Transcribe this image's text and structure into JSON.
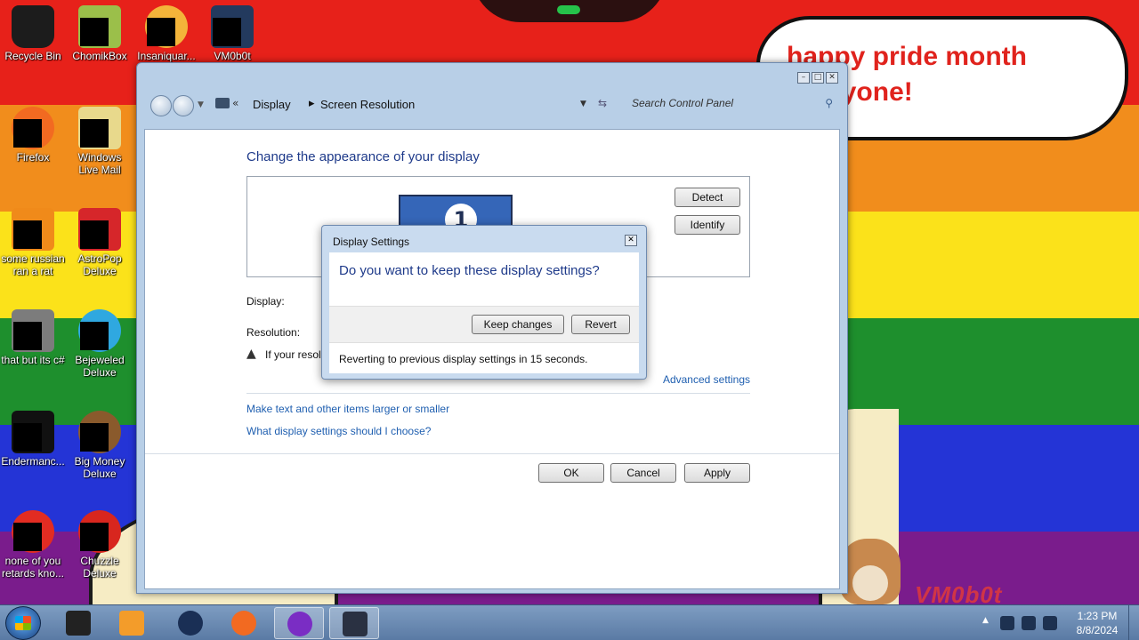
{
  "wallpaper": {
    "bubble_text": "happy pride month everyone!",
    "watermark": "VM0b0t",
    "colors": [
      "#e7211a",
      "#f18d1c",
      "#fbe21a",
      "#1e8f2d",
      "#2434d6",
      "#7a1c8c"
    ]
  },
  "desktop_icons": [
    {
      "label": "Recycle Bin",
      "icon": "recycle-bin-icon"
    },
    {
      "label": "ChomikBox",
      "icon": "chomikbox-icon"
    },
    {
      "label": "Insaniquar...",
      "icon": "insaniquarium-icon"
    },
    {
      "label": "VM0b0t",
      "icon": "vm0b0t-icon"
    },
    {
      "label": "Firefox",
      "icon": "firefox-icon"
    },
    {
      "label": "Windows Live Mail",
      "icon": "windows-live-mail-icon"
    },
    {
      "label": "some russian ran a rat",
      "icon": "russian-rat-icon"
    },
    {
      "label": "AstroPop Deluxe",
      "icon": "astropop-icon"
    },
    {
      "label": "that but its c#",
      "icon": "csharp-icon"
    },
    {
      "label": "Bejeweled Deluxe",
      "icon": "bejeweled-icon"
    },
    {
      "label": "Endermanc...",
      "icon": "endermanch-icon"
    },
    {
      "label": "Big Money Deluxe",
      "icon": "big-money-icon"
    },
    {
      "label": "none of you retards kno...",
      "icon": "none-of-you-icon"
    },
    {
      "label": "Chuzzle Deluxe",
      "icon": "chuzzle-icon"
    }
  ],
  "window": {
    "breadcrumb": [
      "Display",
      "Screen Resolution"
    ],
    "search_placeholder": "Search Control Panel",
    "heading": "Change the appearance of your display",
    "monitor_number": "1",
    "detect_label": "Detect",
    "identify_label": "Identify",
    "display_label": "Display:",
    "resolution_label": "Resolution:",
    "warning_text": "If your resol",
    "advanced_link": "Advanced settings",
    "link_larger": "Make text and other items larger or smaller",
    "link_choose": "What display settings should I choose?",
    "ok_label": "OK",
    "cancel_label": "Cancel",
    "apply_label": "Apply"
  },
  "dialog": {
    "title": "Display Settings",
    "question": "Do you want to keep these display settings?",
    "keep_label": "Keep changes",
    "revert_label": "Revert",
    "countdown_text": "Reverting to previous display settings in 15 seconds."
  },
  "taskbar": {
    "time": "1:23 PM",
    "date": "8/8/2024",
    "pinned": [
      "vm-icon",
      "media-player-icon",
      "globe-icon",
      "firefox-icon",
      "purple-app-icon",
      "display-icon"
    ]
  }
}
